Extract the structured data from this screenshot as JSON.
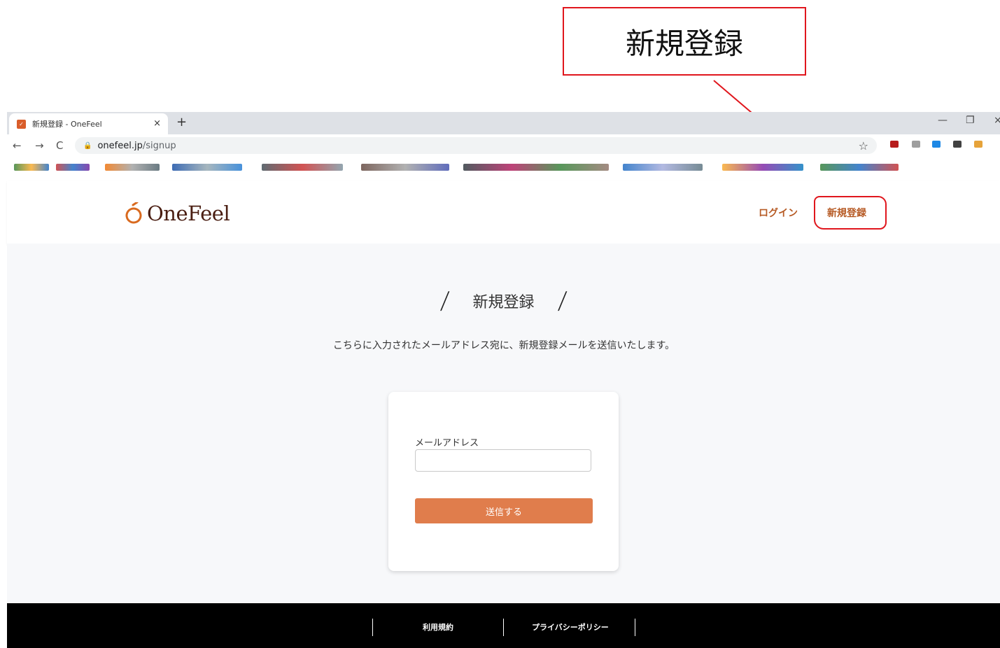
{
  "annotation": {
    "callout_text": "新規登録",
    "color": "#e0161d"
  },
  "browser": {
    "tab_title": "新規登録 - OneFeel",
    "tab_close": "×",
    "new_tab": "+",
    "url_host": "onefeel.jp",
    "url_path": "/signup",
    "nav_back": "←",
    "nav_forward": "→",
    "nav_reload": "C",
    "bookmark_star": "☆",
    "win_minimize": "—",
    "win_restore": "❐",
    "win_close": "×"
  },
  "header": {
    "logo_text": "OneFeel",
    "nav_login": "ログイン",
    "nav_signup": "新規登録",
    "accent_color": "#b65a24"
  },
  "main": {
    "slash_left": "/",
    "slash_right": "/",
    "title": "新規登録",
    "lead_text": "こちらに入力されたメールアドレス宛に、新規登録メールを送信いたします。",
    "form": {
      "email_label": "メールアドレス",
      "email_value": "",
      "submit_label": "送信する",
      "button_color": "#e07d4c"
    }
  },
  "footer": {
    "links": [
      "利用規約",
      "プライバシーポリシー"
    ]
  }
}
